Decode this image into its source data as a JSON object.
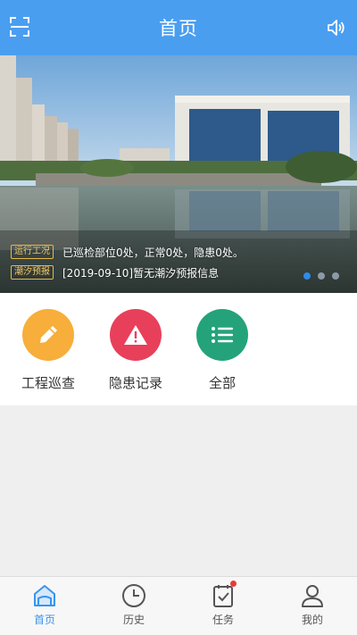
{
  "header": {
    "title": "首页",
    "scan_icon": "scan-icon",
    "sound_icon": "speaker-icon"
  },
  "banner": {
    "rows": [
      {
        "tag": "运行工况",
        "text": "已巡检部位0处，正常0处，隐患0处。"
      },
      {
        "tag": "潮汐预报",
        "text": "[2019-09-10]暂无潮汐预报信息"
      }
    ],
    "slide_count": 3,
    "active_slide": 1
  },
  "actions": [
    {
      "label": "工程巡查",
      "icon": "pen-icon",
      "color": "#f7ae3a"
    },
    {
      "label": "隐患记录",
      "icon": "warning-icon",
      "color": "#e8405a"
    },
    {
      "label": "全部",
      "icon": "list-icon",
      "color": "#24a37a"
    }
  ],
  "bottom_nav": [
    {
      "label": "首页",
      "icon": "home-icon",
      "active": true
    },
    {
      "label": "历史",
      "icon": "clock-icon",
      "active": false
    },
    {
      "label": "任务",
      "icon": "clipboard-check-icon",
      "active": false,
      "badge": true
    },
    {
      "label": "我的",
      "icon": "user-icon",
      "active": false
    }
  ],
  "colors": {
    "primary": "#4a9ef0",
    "nav_active": "#3a95ee",
    "tag_border": "#e8b84a"
  }
}
